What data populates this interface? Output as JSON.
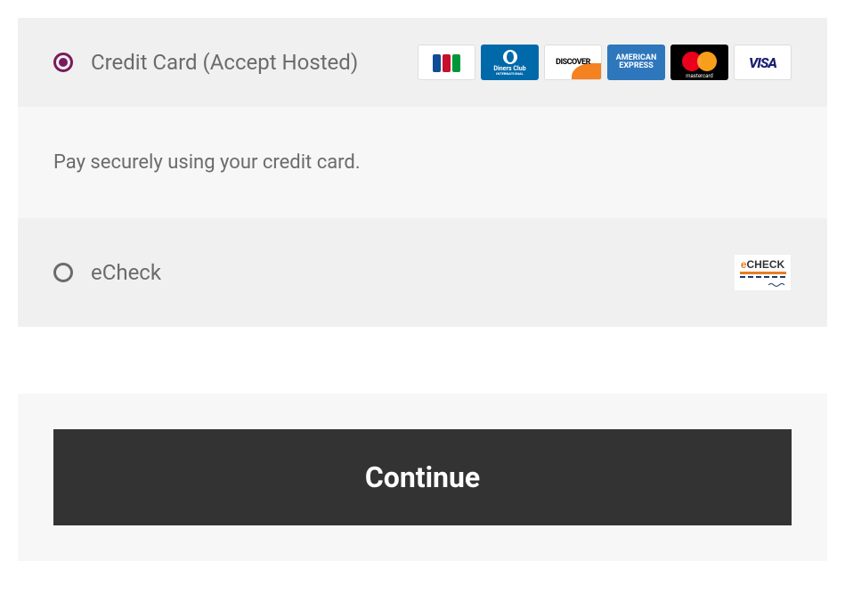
{
  "payment": {
    "options": [
      {
        "label": "Credit Card (Accept Hosted)",
        "selected": true,
        "description": "Pay securely using your credit card.",
        "icons": [
          "jcb",
          "diners",
          "discover",
          "amex",
          "mastercard",
          "visa"
        ]
      },
      {
        "label": "eCheck",
        "selected": false,
        "icons": [
          "echeck"
        ]
      }
    ]
  },
  "actions": {
    "continue_label": "Continue"
  },
  "icon_text": {
    "discover": "DISCOVER",
    "amex_line1": "AMERICAN",
    "amex_line2": "EXPRESS",
    "mastercard": "mastercard",
    "visa": "VISA",
    "diners_line1": "Diners Club",
    "diners_line2": "INTERNATIONAL",
    "echeck_e": "e",
    "echeck_rest": "CHECK"
  }
}
